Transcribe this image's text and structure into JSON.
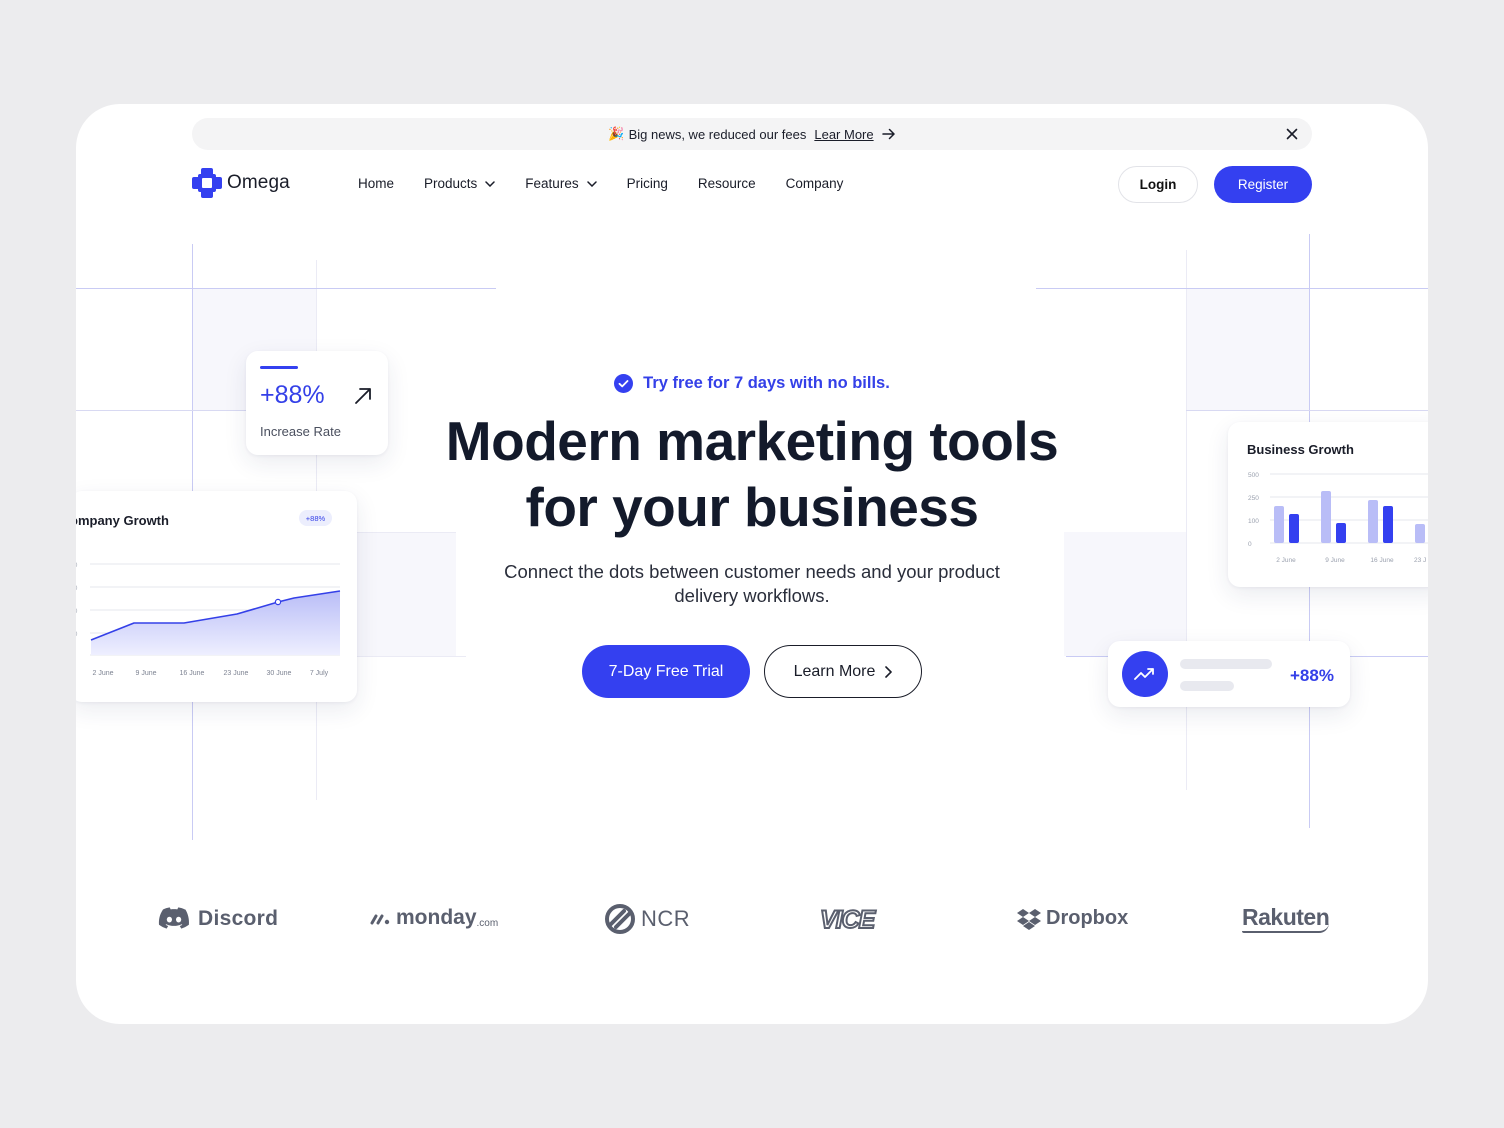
{
  "announcement": {
    "emoji": "🎉",
    "text": "Big news, we reduced our fees",
    "link": "Lear More"
  },
  "brand": {
    "name": "Omega",
    "accent": "#3440F0"
  },
  "nav": {
    "items": [
      {
        "label": "Home",
        "dropdown": false
      },
      {
        "label": "Products",
        "dropdown": true
      },
      {
        "label": "Features",
        "dropdown": true
      },
      {
        "label": "Pricing",
        "dropdown": false
      },
      {
        "label": "Resource",
        "dropdown": false
      },
      {
        "label": "Company",
        "dropdown": false
      }
    ],
    "login": "Login",
    "register": "Register"
  },
  "hero": {
    "pill": "Try free for 7 days with no bills.",
    "title_line1": "Modern marketing tools",
    "title_line2": "for your business",
    "subtitle_line1": "Connect the dots between customer needs and your product",
    "subtitle_line2": "delivery workflows.",
    "cta_primary": "7-Day Free Trial",
    "cta_secondary": "Learn More"
  },
  "cards": {
    "increase": {
      "value": "+88%",
      "label": "Increase Rate"
    },
    "company_growth": {
      "title": "ompany Growth",
      "badge": "+88%",
      "x_labels": [
        "2 June",
        "9 June",
        "16 June",
        "23 June",
        "30 June",
        "7 July"
      ]
    },
    "business_growth": {
      "title": "Business Growth",
      "y_labels": [
        "500",
        "250",
        "100",
        "0"
      ],
      "x_labels": [
        "2 June",
        "9 June",
        "16 June",
        "23 J"
      ]
    },
    "stat": {
      "value": "+88%"
    }
  },
  "logos": [
    "Discord",
    "monday",
    ".com",
    "NCR",
    "VICE",
    "Dropbox",
    "Rakuten"
  ]
}
